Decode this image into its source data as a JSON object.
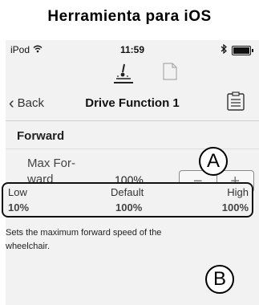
{
  "heading": "Herramienta para iOS",
  "status_bar": {
    "carrier": "iPod",
    "time": "11:59"
  },
  "nav": {
    "back_label": "Back",
    "title": "Drive Function 1"
  },
  "section": {
    "title": "Forward"
  },
  "setting": {
    "name": "Max For-\nward\nSpeed",
    "value": "100%",
    "minus": "−",
    "plus": "+"
  },
  "range": {
    "low_label": "Low",
    "low_value": "10%",
    "default_label": "Default",
    "default_value": "100%",
    "high_label": "High",
    "high_value": "100%"
  },
  "description": "Sets the maximum forward speed of the wheelchair.",
  "callouts": {
    "a": "A",
    "b": "B"
  }
}
